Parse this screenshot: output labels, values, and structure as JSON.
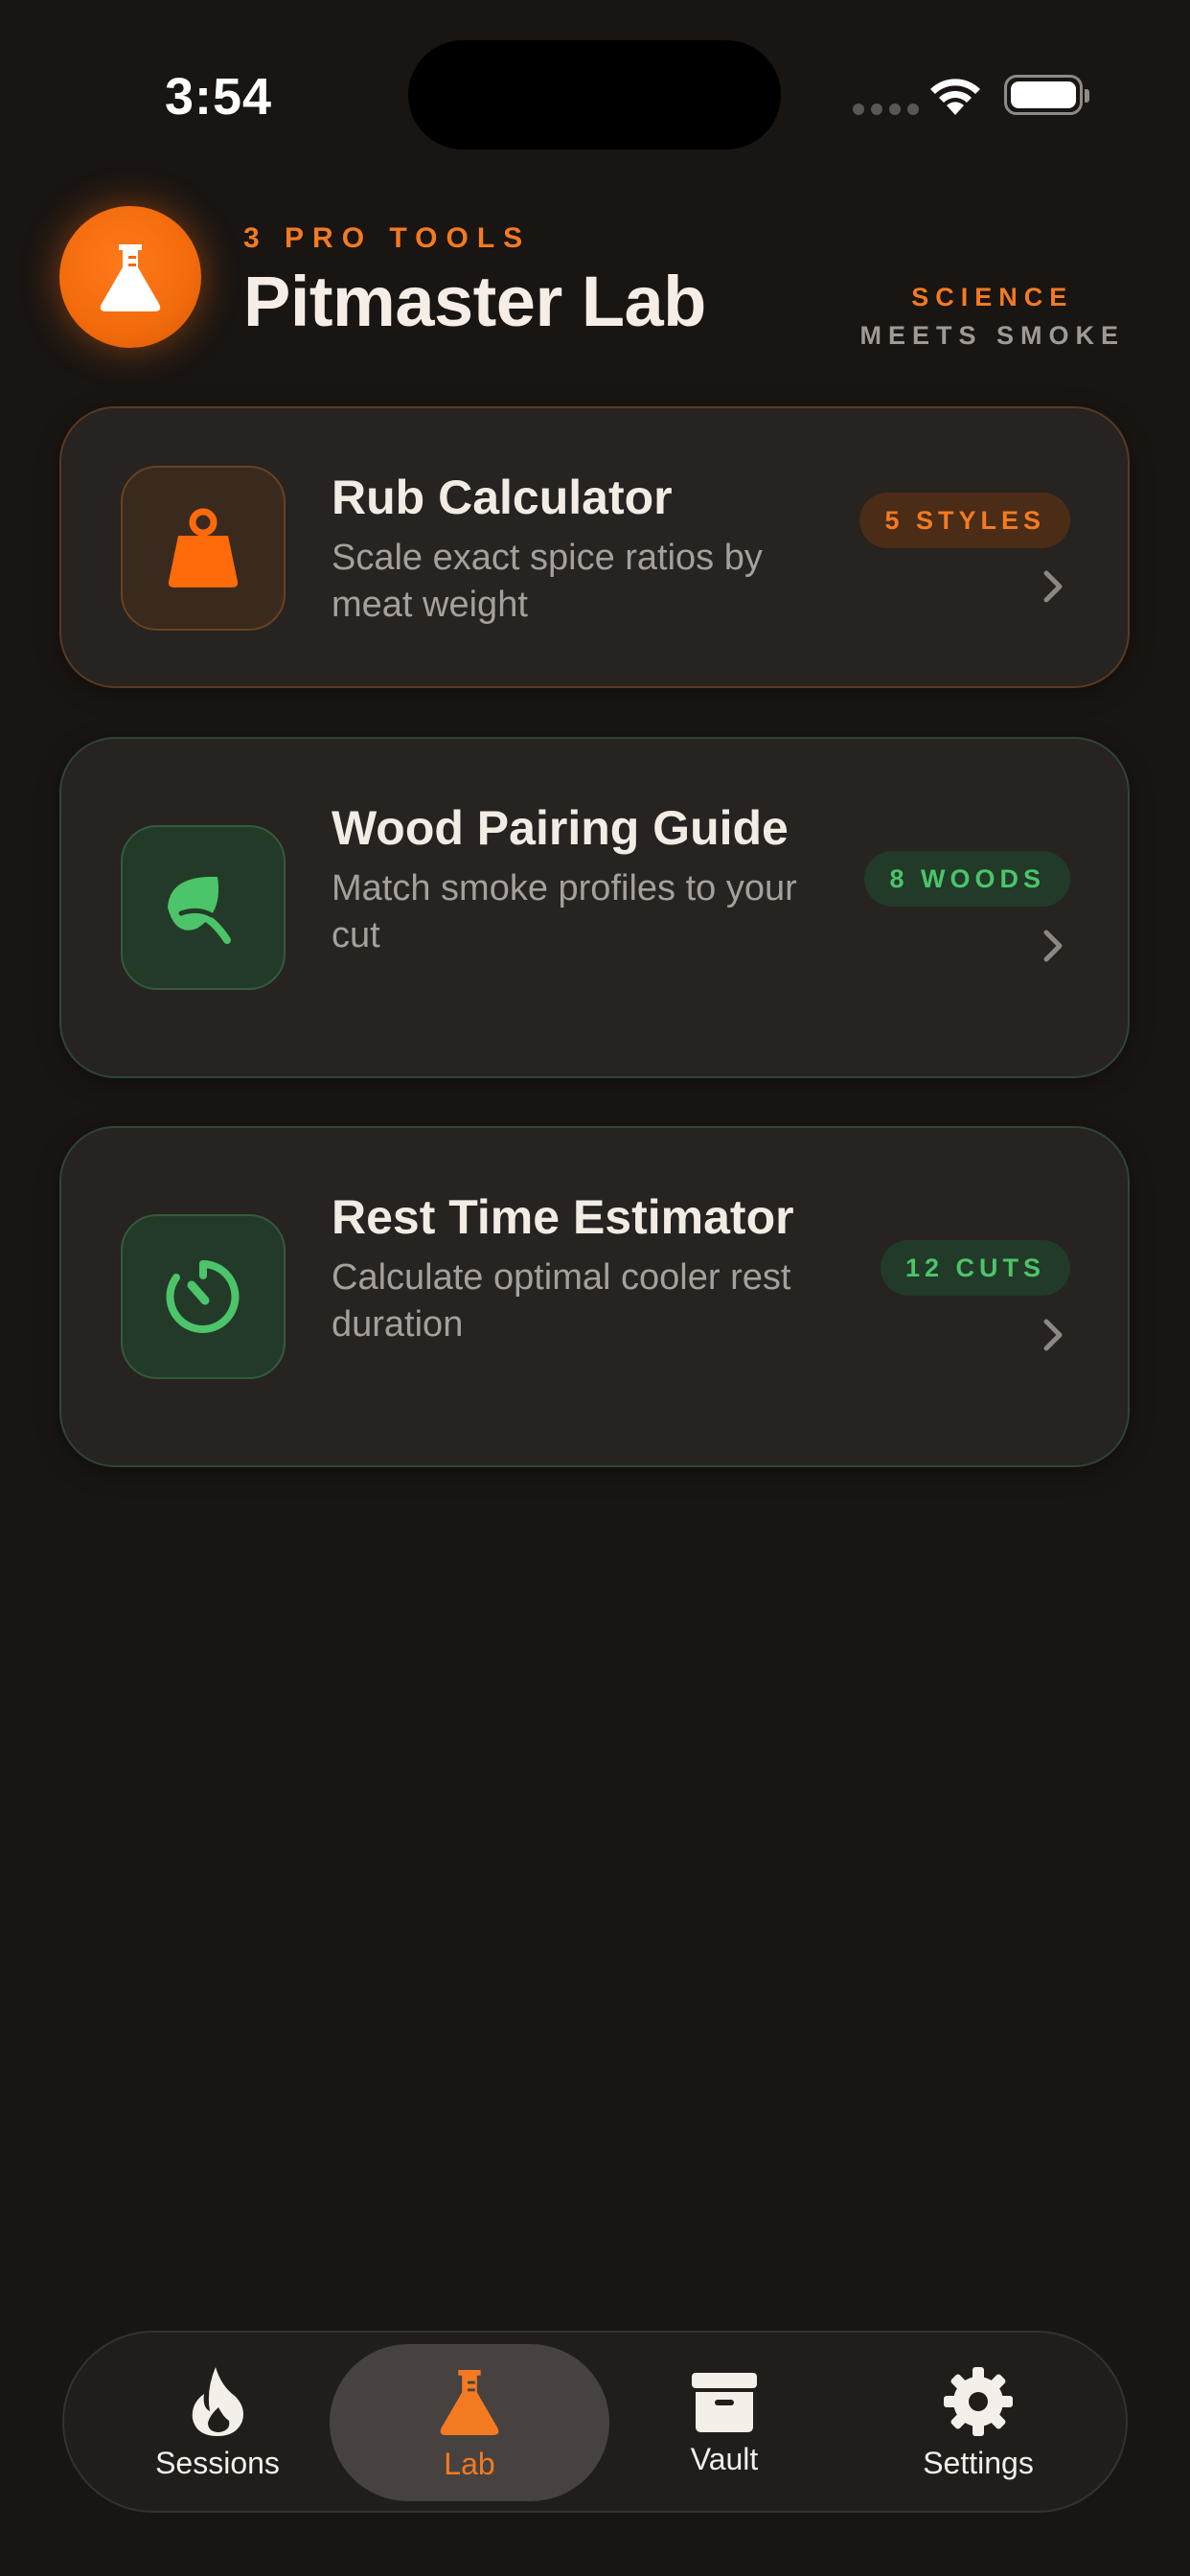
{
  "status_bar": {
    "time": "3:54"
  },
  "header": {
    "kicker": "3 PRO TOOLS",
    "title": "Pitmaster Lab",
    "tagline_line1": "SCIENCE",
    "tagline_line2": "MEETS SMOKE",
    "logo_icon": "flask-icon"
  },
  "cards": [
    {
      "title": "Rub Calculator",
      "description": "Scale exact spice ratios by meat weight",
      "badge": "5 STYLES",
      "icon": "weight-icon",
      "accent": "#f47a22"
    },
    {
      "title": "Wood Pairing Guide",
      "description": "Match smoke profiles to your cut",
      "badge": "8 WOODS",
      "icon": "leaf-icon",
      "accent": "#4cc46a"
    },
    {
      "title": "Rest Time Estimator",
      "description": "Calculate optimal cooler rest duration",
      "badge": "12 CUTS",
      "icon": "timer-icon",
      "accent": "#4cc46a"
    }
  ],
  "tabbar": {
    "items": [
      {
        "label": "Sessions",
        "icon": "flame-icon",
        "active": false
      },
      {
        "label": "Lab",
        "icon": "flask-icon",
        "active": true
      },
      {
        "label": "Vault",
        "icon": "archive-box-icon",
        "active": false
      },
      {
        "label": "Settings",
        "icon": "gear-icon",
        "active": false
      }
    ],
    "active_color": "#f47a22"
  },
  "colors": {
    "background": "#191512",
    "brand_orange": "#f47a22",
    "green": "#4cc46a"
  }
}
